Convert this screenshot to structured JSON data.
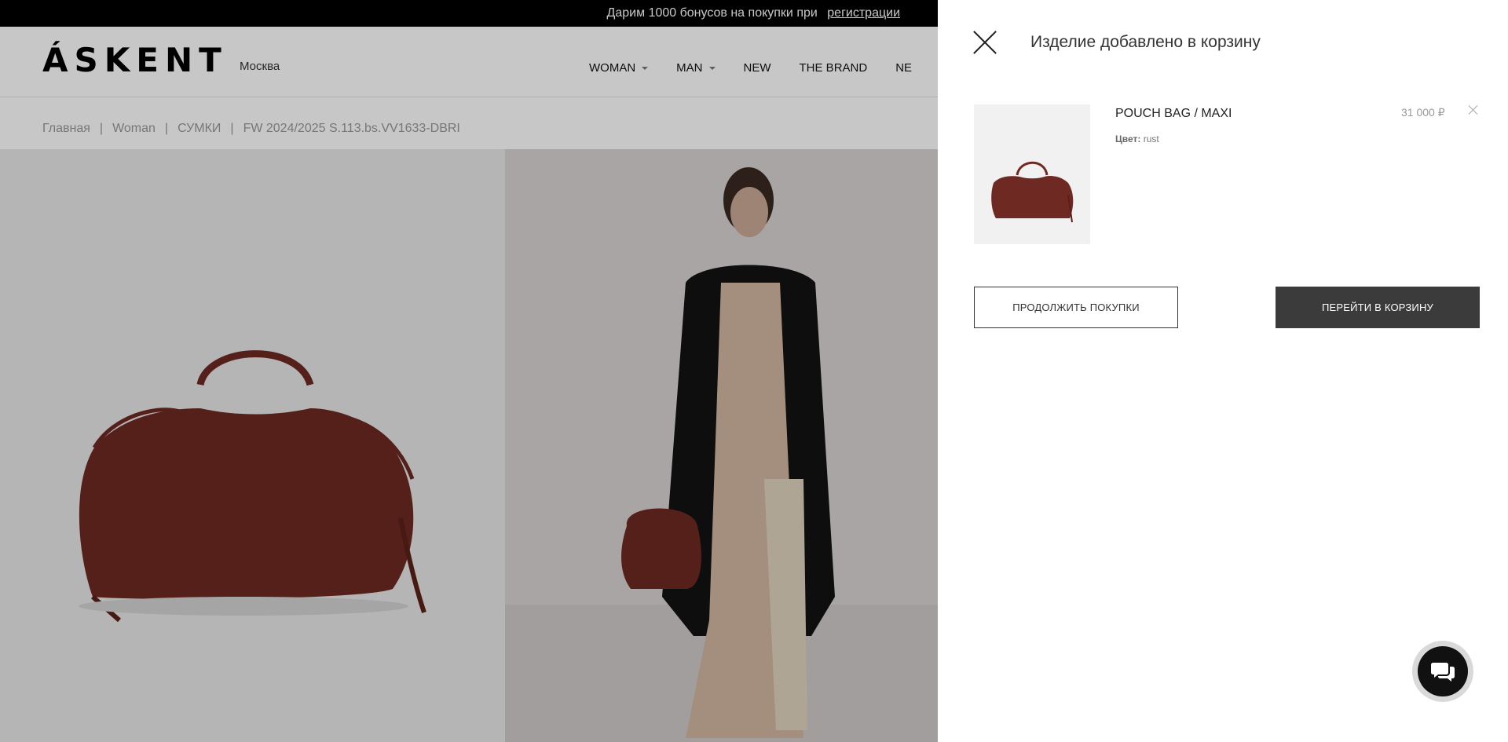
{
  "promo": {
    "text": "Дарим 1000 бонусов на покупки при",
    "link": "регистрации"
  },
  "header": {
    "logo": "ÁSKENT",
    "city": "Москва",
    "nav": [
      {
        "label": "WOMAN",
        "dropdown": true
      },
      {
        "label": "MAN",
        "dropdown": true
      },
      {
        "label": "NEW",
        "dropdown": false
      },
      {
        "label": "THE BRAND",
        "dropdown": false
      },
      {
        "label": "NE",
        "dropdown": false
      }
    ]
  },
  "breadcrumb": {
    "items": [
      "Главная",
      "Woman",
      "СУМКИ",
      "FW 2024/2025 S.113.bs.VV1633-DBRI"
    ],
    "separator": "|"
  },
  "cart_drawer": {
    "title": "Изделие добавлено в корзину",
    "item": {
      "name": "POUCH BAG / MAXI",
      "color_label": "Цвет:",
      "color_value": "rust",
      "price": "31 000 ₽"
    },
    "continue_label": "ПРОДОЛЖИТЬ ПОКУПКИ",
    "go_to_cart_label": "ПЕРЕЙТИ В КОРЗИНУ"
  },
  "colors": {
    "bag": "#6e2a22",
    "dark_button": "#3b3b3b",
    "promo_bg": "#000000"
  },
  "icons": {
    "close": "close-icon",
    "remove": "remove-item-icon",
    "chat": "chat-icon",
    "caret": "chevron-down-icon"
  }
}
